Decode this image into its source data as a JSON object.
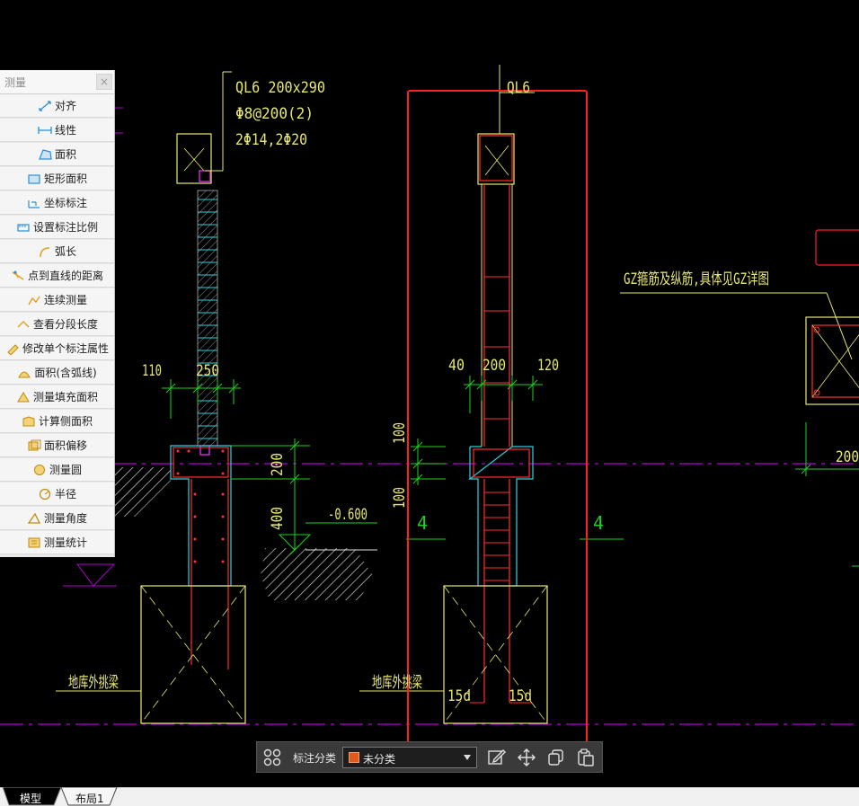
{
  "drawing": {
    "left_beam_label": "QL6 200x290",
    "left_beam_stirrup": "Φ8@200(2)",
    "left_beam_bars": "2Φ14,2Φ20",
    "left_dim_110": "110",
    "left_dim_250": "250",
    "left_dim_200": "200",
    "left_dim_400": "400",
    "elevation": "-0.600",
    "left_foundation_label": "地库外挑梁",
    "center_beam_label": "QL6",
    "center_dim_40": "40",
    "center_dim_200": "200",
    "center_dim_120": "120",
    "center_dim_100_upper": "100",
    "center_dim_100_lower": "100",
    "section_mark_left": "4",
    "section_mark_right": "4",
    "center_foundation_label": "地库外挑梁",
    "anchor_left": "15d",
    "anchor_right": "15d",
    "gz_note": "GZ箍筋及纵筋,具体见GZ详图",
    "right_dim_200": "200"
  },
  "measure_panel": {
    "title": "测量",
    "close": "×",
    "tools": [
      {
        "label": "对齐",
        "icon": "align-dimension-icon"
      },
      {
        "label": "线性",
        "icon": "linear-dimension-icon"
      },
      {
        "label": "面积",
        "icon": "area-icon"
      },
      {
        "label": "矩形面积",
        "icon": "rectangle-area-icon"
      },
      {
        "label": "坐标标注",
        "icon": "coordinate-icon"
      },
      {
        "label": "设置标注比例",
        "icon": "scale-icon"
      },
      {
        "label": "弧长",
        "icon": "arc-length-icon"
      },
      {
        "label": "点到直线的距离",
        "icon": "point-to-line-icon"
      },
      {
        "label": "连续测量",
        "icon": "continuous-measure-icon"
      },
      {
        "label": "查看分段长度",
        "icon": "segment-length-icon"
      },
      {
        "label": "修改单个标注属性",
        "icon": "edit-dimension-icon"
      },
      {
        "label": "面积(含弧线)",
        "icon": "arc-area-icon"
      },
      {
        "label": "测量填充面积",
        "icon": "hatch-area-icon"
      },
      {
        "label": "计算侧面积",
        "icon": "side-area-icon"
      },
      {
        "label": "面积偏移",
        "icon": "area-offset-icon"
      },
      {
        "label": "测量圆",
        "icon": "circle-measure-icon"
      },
      {
        "label": "半径",
        "icon": "radius-icon"
      },
      {
        "label": "测量角度",
        "icon": "angle-icon"
      },
      {
        "label": "测量统计",
        "icon": "statistics-icon"
      }
    ]
  },
  "toolbar": {
    "category_label": "标注分类",
    "category_value": "未分类",
    "swatch_color": "#e05a1e"
  },
  "tabs": {
    "model": "模型",
    "layout1": "布局1"
  }
}
